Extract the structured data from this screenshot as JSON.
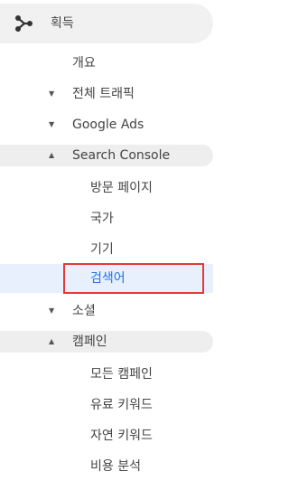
{
  "acquisition": {
    "label": "획득",
    "icon": "acquisition-fork-icon"
  },
  "items": {
    "overview": "개요",
    "all_traffic": "전체 트래픽",
    "google_ads": "Google Ads",
    "search_console": "Search Console",
    "landing_pages": "방문 페이지",
    "countries": "국가",
    "devices": "기기",
    "queries": "검색어",
    "social": "소셜",
    "campaigns": "캠페인",
    "all_campaigns": "모든 캠페인",
    "paid_keywords": "유료 키워드",
    "organic_keywords": "자연 키워드",
    "cost_analysis": "비용 분석"
  },
  "glyphs": {
    "collapsed": "▼",
    "expanded": "▲"
  },
  "colors": {
    "selected_bg": "#e8f0fe",
    "selected_text": "#1a73e8",
    "highlight_border": "#e53935"
  }
}
